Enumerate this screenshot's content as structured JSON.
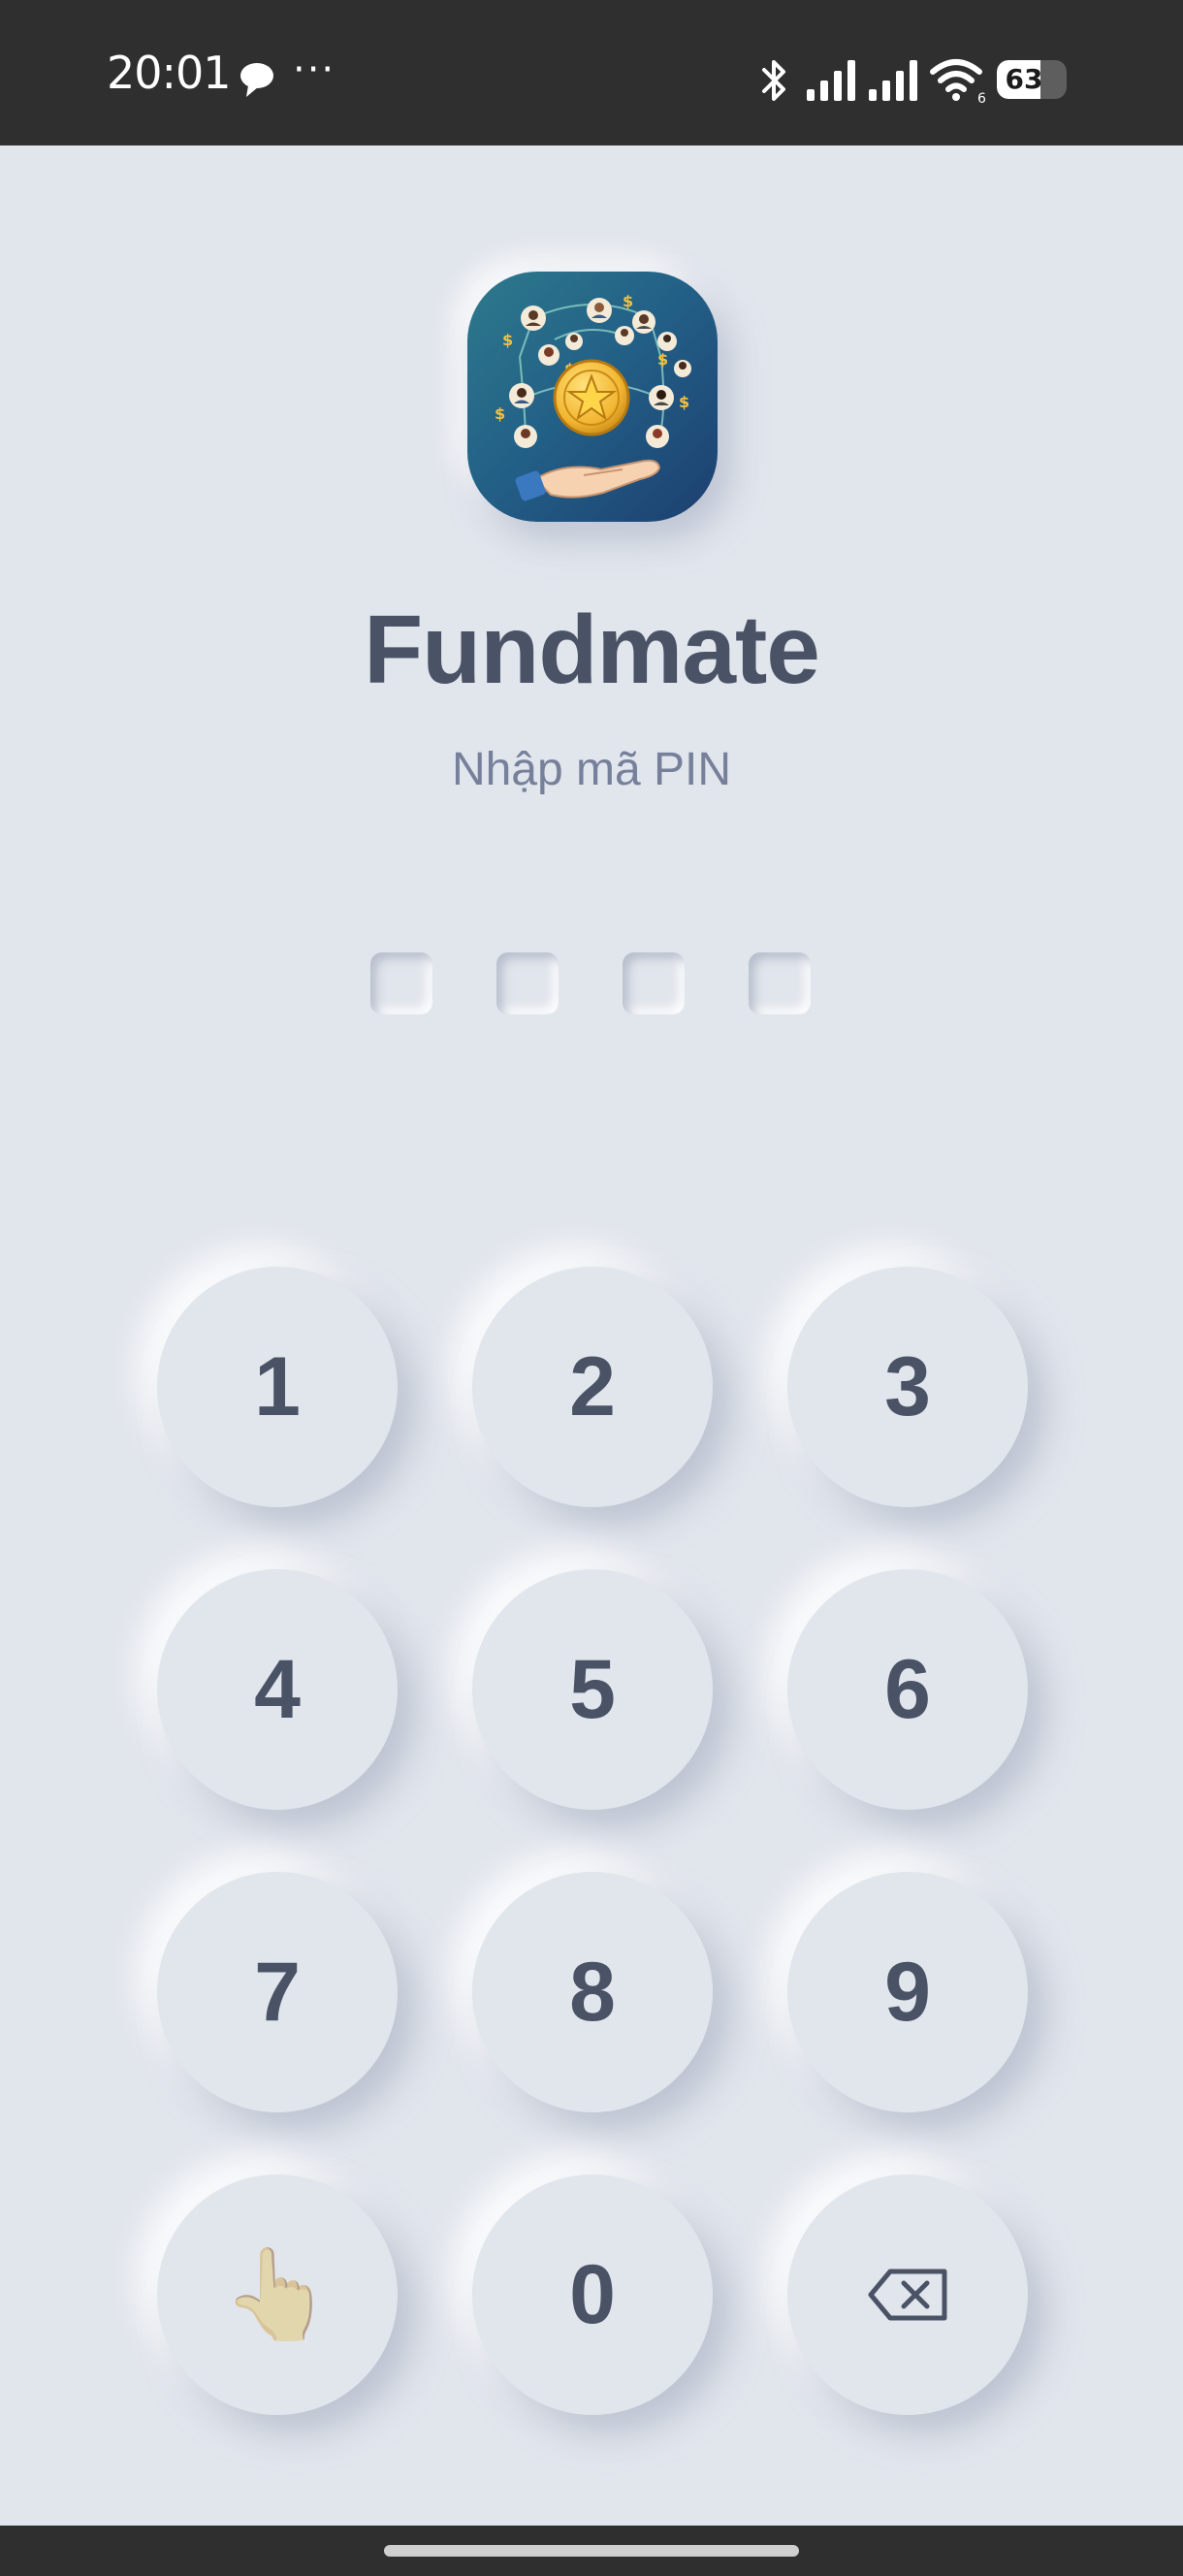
{
  "status_bar": {
    "time": "20:01",
    "more": "···",
    "battery_level": "63",
    "wifi_badge": "6",
    "icons": [
      "message-icon",
      "bluetooth-icon",
      "signal-icon",
      "signal-icon",
      "wifi-icon",
      "battery-icon"
    ]
  },
  "app": {
    "title": "Fundmate",
    "subtitle": "Nhập mã PIN"
  },
  "pin": {
    "length": 4,
    "entered": 0
  },
  "keypad": {
    "keys": [
      "1",
      "2",
      "3",
      "4",
      "5",
      "6",
      "7",
      "8",
      "9",
      "",
      "0",
      ""
    ],
    "fingerprint_icon": "👆",
    "special_icons": [
      "fingerprint-icon",
      "backspace-icon"
    ]
  },
  "colors": {
    "background": "#e1e5ec",
    "text_dark": "#4a5266",
    "text_muted": "#76809a",
    "status_bar": "#2f2f2f",
    "coin": "#f2b632",
    "logo_bg": "#22527a"
  }
}
